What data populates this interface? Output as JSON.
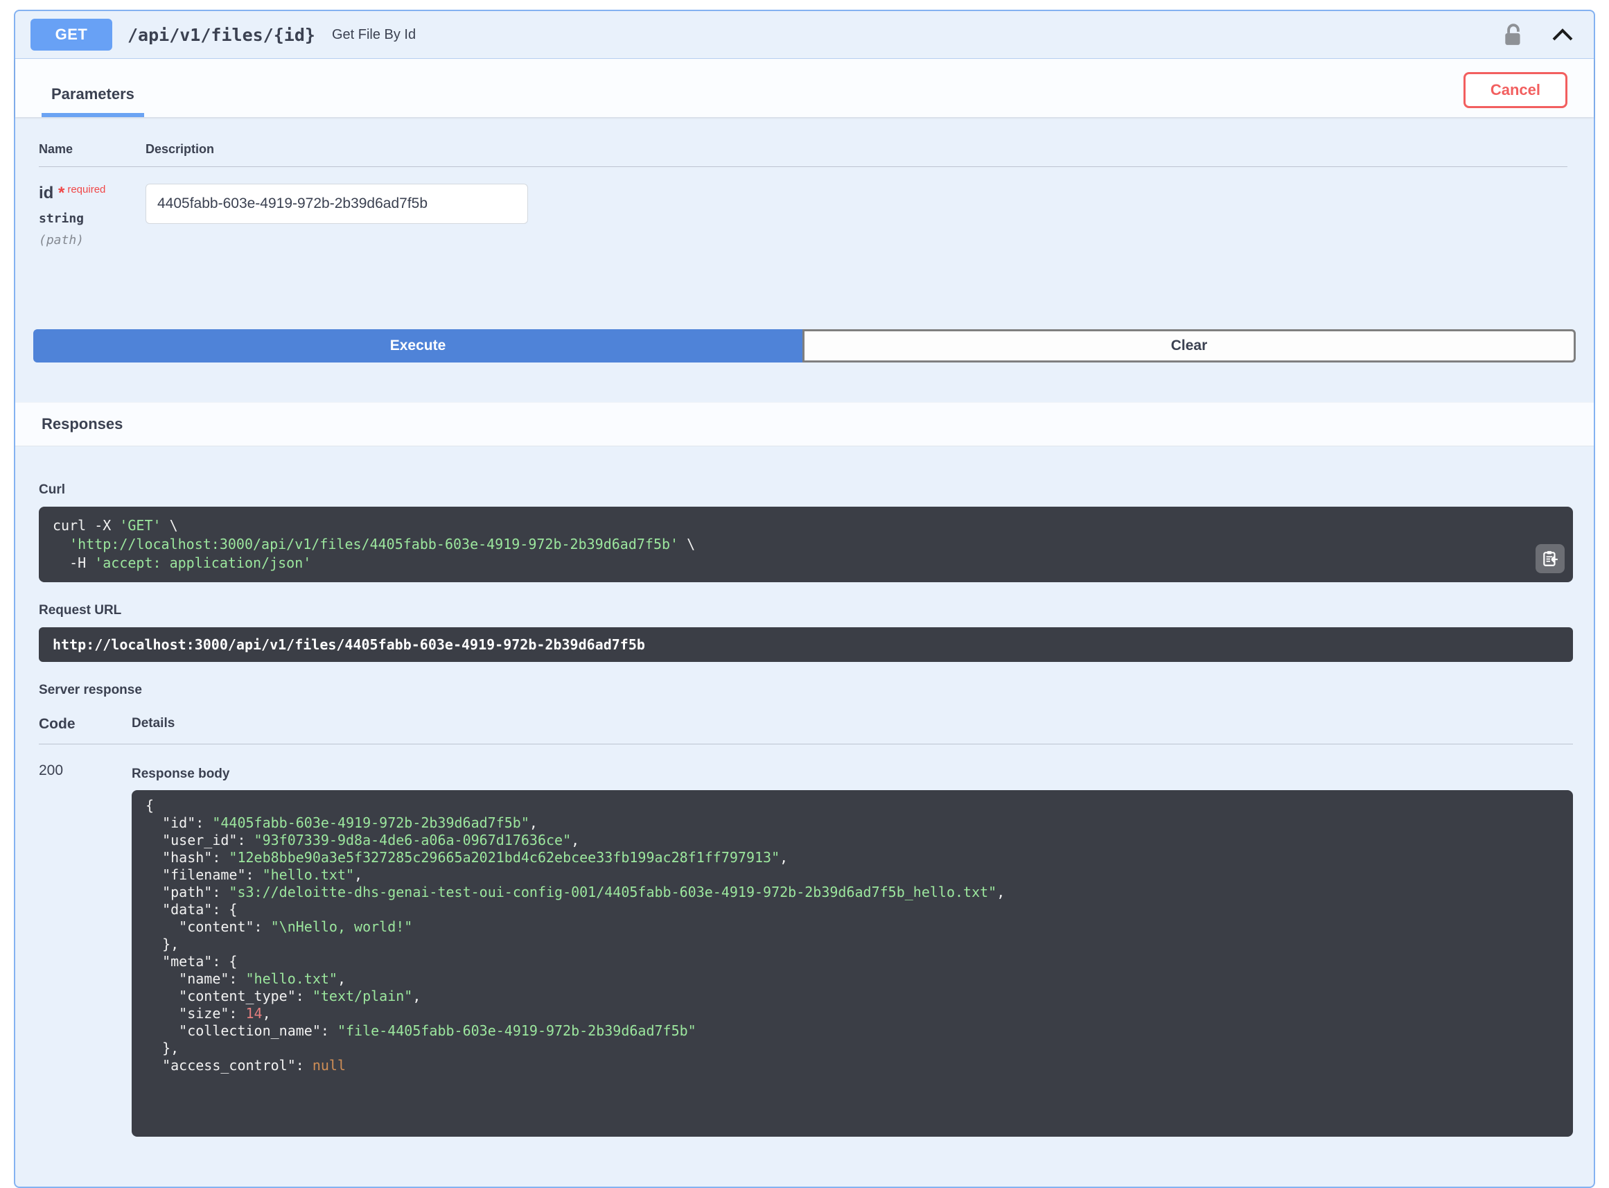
{
  "endpoint": {
    "method": "GET",
    "path": "/api/v1/files/{id}",
    "summary": "Get File By Id"
  },
  "parameters": {
    "title": "Parameters",
    "cancel_label": "Cancel",
    "name_header": "Name",
    "description_header": "Description",
    "param": {
      "name": "id",
      "required_mark": "*",
      "required_label": "required",
      "type": "string",
      "location": "(path)",
      "value": "4405fabb-603e-4919-972b-2b39d6ad7f5b"
    }
  },
  "actions": {
    "execute_label": "Execute",
    "clear_label": "Clear"
  },
  "responses": {
    "title": "Responses",
    "curl_label": "Curl",
    "curl_segments": [
      {
        "t": "plain",
        "text": "curl -X "
      },
      {
        "t": "str",
        "text": "'GET'"
      },
      {
        "t": "plain",
        "text": " \\\n  "
      },
      {
        "t": "str",
        "text": "'http://localhost:3000/api/v1/files/4405fabb-603e-4919-972b-2b39d6ad7f5b'"
      },
      {
        "t": "plain",
        "text": " \\\n  -H "
      },
      {
        "t": "str",
        "text": "'accept: application/json'"
      }
    ],
    "request_url_label": "Request URL",
    "request_url": "http://localhost:3000/api/v1/files/4405fabb-603e-4919-972b-2b39d6ad7f5b",
    "server_response_label": "Server response",
    "code_header": "Code",
    "details_header": "Details",
    "status_code": "200",
    "response_body_label": "Response body",
    "response_segments": [
      {
        "t": "plain",
        "text": "{\n  \"id\": "
      },
      {
        "t": "str",
        "text": "\"4405fabb-603e-4919-972b-2b39d6ad7f5b\""
      },
      {
        "t": "plain",
        "text": ",\n  \"user_id\": "
      },
      {
        "t": "str",
        "text": "\"93f07339-9d8a-4de6-a06a-0967d17636ce\""
      },
      {
        "t": "plain",
        "text": ",\n  \"hash\": "
      },
      {
        "t": "str",
        "text": "\"12eb8bbe90a3e5f327285c29665a2021bd4c62ebcee33fb199ac28f1ff797913\""
      },
      {
        "t": "plain",
        "text": ",\n  \"filename\": "
      },
      {
        "t": "str",
        "text": "\"hello.txt\""
      },
      {
        "t": "plain",
        "text": ",\n  \"path\": "
      },
      {
        "t": "str",
        "text": "\"s3://deloitte-dhs-genai-test-oui-config-001/4405fabb-603e-4919-972b-2b39d6ad7f5b_hello.txt\""
      },
      {
        "t": "plain",
        "text": ",\n  \"data\": {\n    \"content\": "
      },
      {
        "t": "str",
        "text": "\"\\nHello, world!\""
      },
      {
        "t": "plain",
        "text": "\n  },\n  \"meta\": {\n    \"name\": "
      },
      {
        "t": "str",
        "text": "\"hello.txt\""
      },
      {
        "t": "plain",
        "text": ",\n    \"content_type\": "
      },
      {
        "t": "str",
        "text": "\"text/plain\""
      },
      {
        "t": "plain",
        "text": ",\n    \"size\": "
      },
      {
        "t": "num",
        "text": "14"
      },
      {
        "t": "plain",
        "text": ",\n    \"collection_name\": "
      },
      {
        "t": "str",
        "text": "\"file-4405fabb-603e-4919-972b-2b39d6ad7f5b\""
      },
      {
        "t": "plain",
        "text": "\n  },\n  \"access_control\": "
      },
      {
        "t": "null",
        "text": "null"
      }
    ]
  },
  "icons": {
    "auth": "unlock-icon",
    "collapse": "chevron-up-icon",
    "copy": "clipboard-copy-icon"
  },
  "colors": {
    "opblock_border": "#84b2f1",
    "opblock_bg": "#e9f1fb",
    "method_badge": "#68a1f5",
    "execute_button": "#4f83d8",
    "cancel_red": "#f25f5f",
    "code_block_bg": "#3b3e46",
    "string_token": "#9ce79e",
    "number_token": "#e57e7e",
    "null_token": "#cf8e56"
  }
}
